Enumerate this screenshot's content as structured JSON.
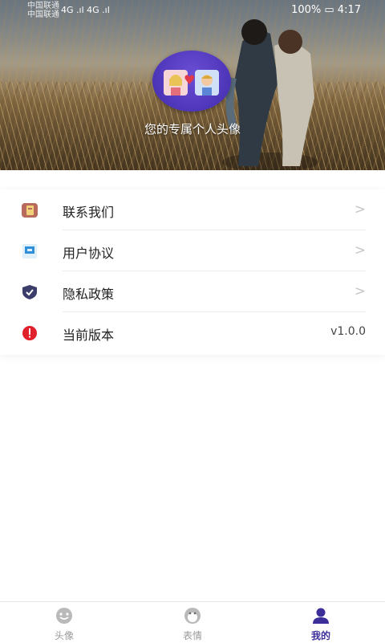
{
  "status_bar": {
    "carrier_line1": "中国联通",
    "carrier_line2": "中国联通",
    "signal": "4G .ıl 4G .ıl",
    "right": "100% ▭ 4:17"
  },
  "header": {
    "caption": "您的专属个人头像"
  },
  "menu": {
    "items": [
      {
        "label": "联系我们",
        "icon": "contact-book-icon",
        "has_chevron": true
      },
      {
        "label": "用户协议",
        "icon": "document-icon",
        "has_chevron": true
      },
      {
        "label": "隐私政策",
        "icon": "shield-check-icon",
        "has_chevron": true
      },
      {
        "label": "当前版本",
        "icon": "alert-icon",
        "value": "v1.0.0"
      }
    ],
    "chevron": ">"
  },
  "bottom_nav": {
    "tabs": [
      {
        "label": "头像",
        "icon": "smiley-icon",
        "active": false
      },
      {
        "label": "表情",
        "icon": "penguin-icon",
        "active": false
      },
      {
        "label": "我的",
        "icon": "user-icon",
        "active": true
      }
    ]
  },
  "colors": {
    "accent": "#3d2f9a",
    "inactive": "#9a9a9a",
    "avatar_bg": "#5a3fc8"
  }
}
